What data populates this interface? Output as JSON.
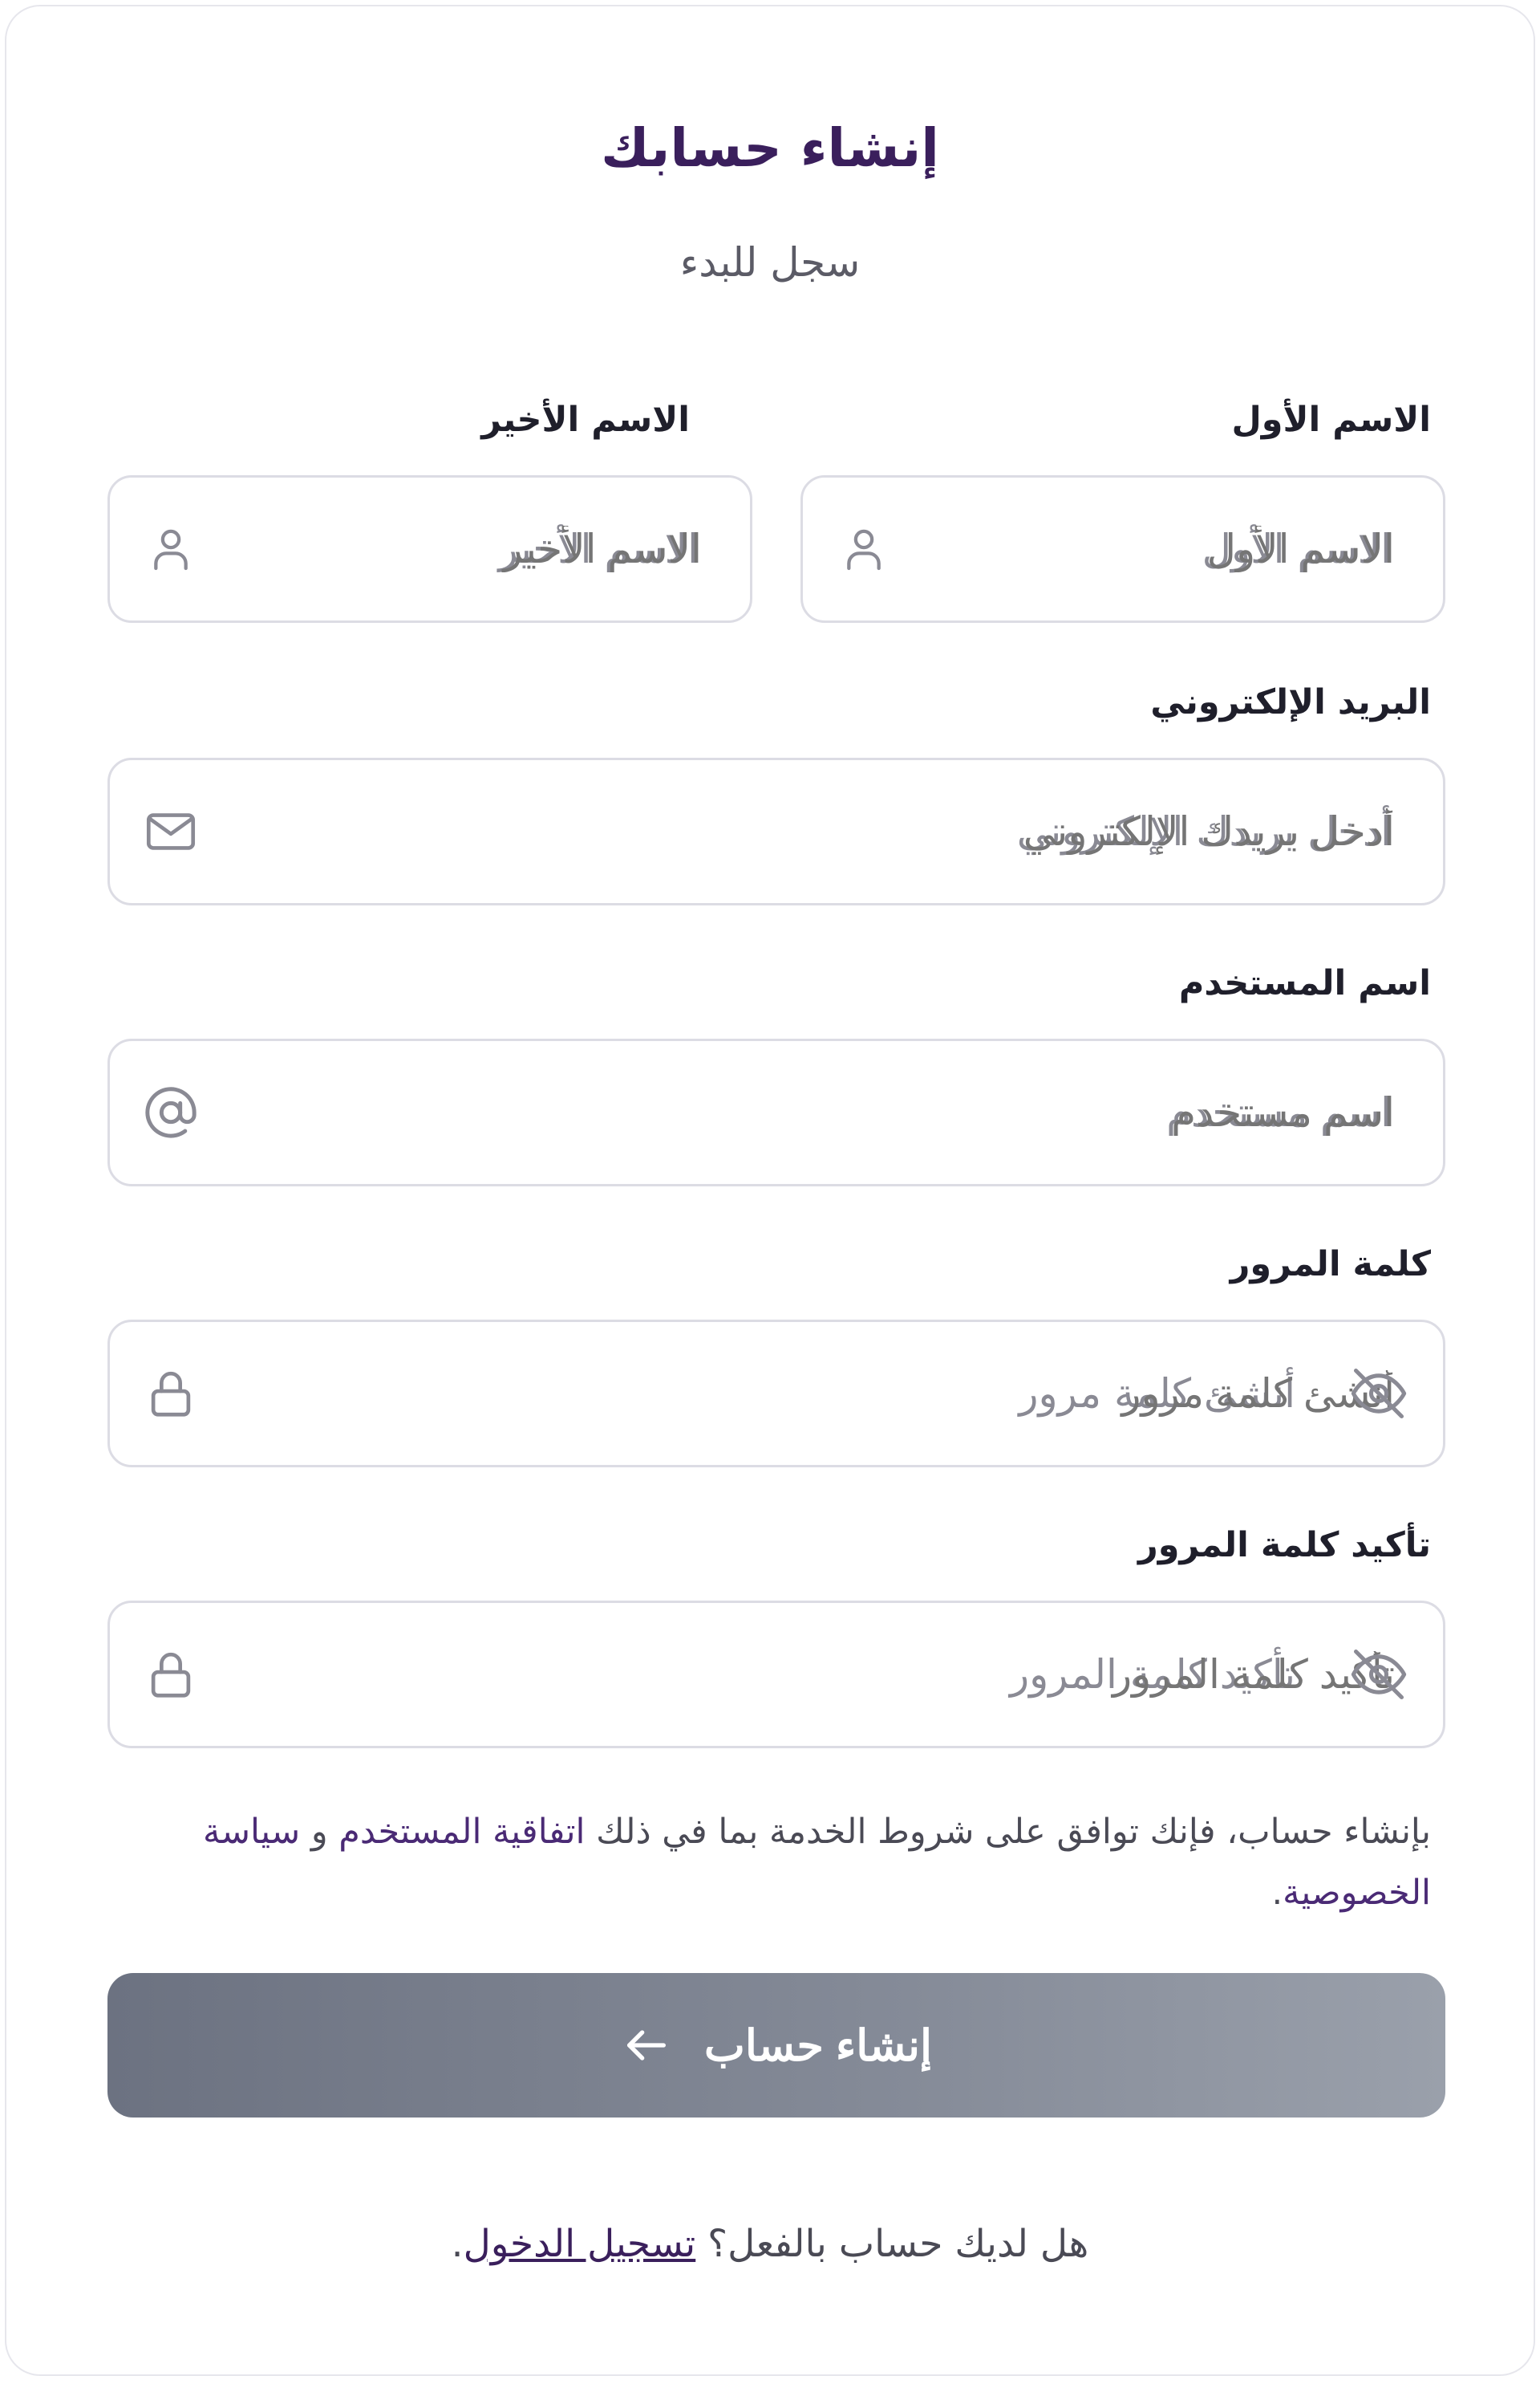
{
  "header": {
    "title": "إنشاء حسابك",
    "subtitle": "سجل للبدء"
  },
  "form": {
    "first_name": {
      "label": "الاسم الأول",
      "placeholder": "الاسم الأول",
      "value": "",
      "icon": "user-icon"
    },
    "last_name": {
      "label": "الاسم الأخير",
      "placeholder": "الاسم الأخير",
      "value": "",
      "icon": "user-icon"
    },
    "email": {
      "label": "البريد الإلكتروني",
      "placeholder": "أدخل بريدك الإلكتروني",
      "value": "",
      "icon": "mail-icon"
    },
    "username": {
      "label": "اسم المستخدم",
      "placeholder": "اسم مستخدم",
      "value": "",
      "icon": "at-sign-icon"
    },
    "password": {
      "label": "كلمة المرور",
      "placeholder": "أنشئ كلمة مرور",
      "value": "",
      "icon": "lock-icon",
      "toggle_icon": "eye-off-icon"
    },
    "confirm_password": {
      "label": "تأكيد كلمة المرور",
      "placeholder": "تأكيد كلمة المرور",
      "value": "",
      "icon": "lock-icon",
      "toggle_icon": "eye-off-icon"
    }
  },
  "terms": {
    "prefix": "بإنشاء حساب، فإنك توافق على شروط الخدمة بما في ذلك ",
    "user_agreement": "اتفاقية المستخدم",
    "conjunction": " و ",
    "privacy_policy": "سياسة الخصوصية",
    "suffix": "."
  },
  "submit": {
    "label": "إنشاء حساب",
    "icon": "arrow-left-icon"
  },
  "footer": {
    "question": "هل لديك حساب بالفعل؟ ",
    "login_link": "تسجيل الدخول",
    "suffix": "."
  },
  "colors": {
    "title": "#3a1f5c",
    "link": "#4a2a75",
    "button_start": "#9aa0ab",
    "button_end": "#6c7281",
    "field_border": "#dcdce4"
  }
}
